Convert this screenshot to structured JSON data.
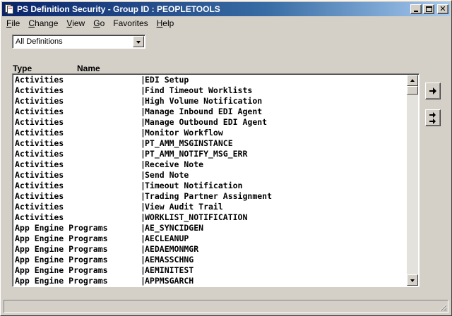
{
  "window": {
    "title": "PS Definition Security - Group ID : PEOPLETOOLS"
  },
  "menu": [
    {
      "label": "File",
      "u": "F",
      "rest": "ile"
    },
    {
      "label": "Change",
      "u": "C",
      "rest": "hange"
    },
    {
      "label": "View",
      "u": "V",
      "rest": "iew"
    },
    {
      "label": "Go",
      "u": "G",
      "rest": "o"
    },
    {
      "label": "Favorites",
      "u": "F",
      "rest": "avorites",
      "pre": "",
      "underline_index": 0
    },
    {
      "label": "Help",
      "u": "H",
      "rest": "elp"
    }
  ],
  "filter": {
    "selected": "All Definitions"
  },
  "columns": {
    "type": "Type",
    "name": "Name"
  },
  "rows": [
    {
      "type": "Activities",
      "name": "EDI Setup"
    },
    {
      "type": "Activities",
      "name": "Find Timeout Worklists"
    },
    {
      "type": "Activities",
      "name": "High Volume Notification"
    },
    {
      "type": "Activities",
      "name": "Manage Inbound EDI Agent"
    },
    {
      "type": "Activities",
      "name": "Manage Outbound EDI Agent"
    },
    {
      "type": "Activities",
      "name": "Monitor Workflow"
    },
    {
      "type": "Activities",
      "name": "PT_AMM_MSGINSTANCE"
    },
    {
      "type": "Activities",
      "name": "PT_AMM_NOTIFY_MSG_ERR"
    },
    {
      "type": "Activities",
      "name": "Receive Note"
    },
    {
      "type": "Activities",
      "name": "Send Note"
    },
    {
      "type": "Activities",
      "name": "Timeout Notification"
    },
    {
      "type": "Activities",
      "name": "Trading Partner Assignment"
    },
    {
      "type": "Activities",
      "name": "View Audit Trail"
    },
    {
      "type": "Activities",
      "name": "WORKLIST_NOTIFICATION"
    },
    {
      "type": "App Engine Programs",
      "name": "AE_SYNCIDGEN"
    },
    {
      "type": "App Engine Programs",
      "name": "AECLEANUP"
    },
    {
      "type": "App Engine Programs",
      "name": "AEDAEMONMGR"
    },
    {
      "type": "App Engine Programs",
      "name": "AEMASSCHNG"
    },
    {
      "type": "App Engine Programs",
      "name": "AEMINITEST"
    },
    {
      "type": "App Engine Programs",
      "name": "APPMSGARCH"
    }
  ],
  "separator": "|",
  "scroll_position": 0.0
}
